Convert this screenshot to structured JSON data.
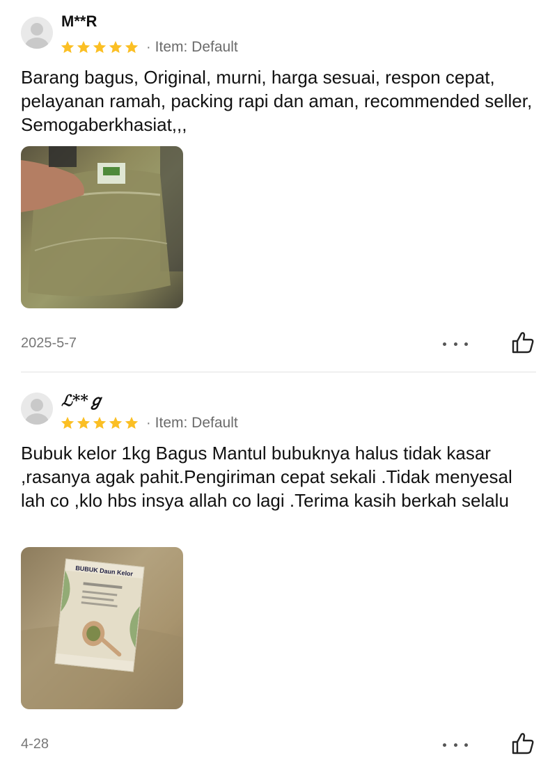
{
  "reviews": [
    {
      "username": "M**R",
      "rating": 5,
      "rating_max": 5,
      "item_label": "Item: Default",
      "text": "Barang bagus, Original, murni, harga sesuai, respon cepat, pelayanan ramah, packing rapi dan aman, recommended seller, Semogaberkhasiat,,,",
      "date": "2025-5-7"
    },
    {
      "username": "ℒ**ℊ",
      "rating": 5,
      "rating_max": 5,
      "item_label": "Item: Default",
      "text": "Bubuk kelor 1kg Bagus Mantul bubuknya halus tidak kasar ,rasanya agak pahit.Pengiriman cepat sekali .Tidak menyesal lah co ,klo hbs insya allah co lagi .Terima kasih berkah selalu",
      "date": "4-28",
      "photo_label": "BUBUK Daun Kelor"
    }
  ],
  "separator": "·",
  "icons": {
    "avatar": "default-user-icon",
    "star": "star-icon",
    "more": "more-options-icon",
    "like": "thumbs-up-icon"
  },
  "colors": {
    "star": "#FBBF24",
    "text_primary": "#111111",
    "text_secondary": "#777777"
  }
}
